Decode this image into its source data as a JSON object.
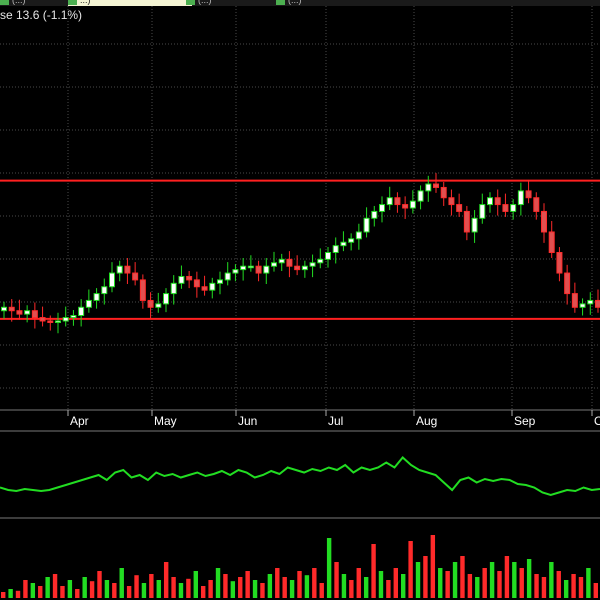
{
  "header": {
    "legend_text": "se 13.6 (-1.1%)",
    "tabs": [
      {
        "label": "(...)",
        "color": "#4caf50"
      },
      {
        "label": "...)",
        "color": "#4caf50"
      },
      {
        "label": "(...)",
        "color": "#4caf50"
      },
      {
        "label": "(...)",
        "color": "#4caf50"
      }
    ]
  },
  "colors": {
    "background": "#000000",
    "grid": "#4a4a4a",
    "up": "#22dd22",
    "down": "#ff2a2a",
    "candle_up_body": "#ffffff",
    "candle_down_body": "#e05050",
    "line": "#22dd22",
    "level_lines": "#ff2020",
    "axis_text": "#ffffff"
  },
  "chart_data": [
    {
      "type": "candlestick",
      "title": "",
      "x_tick_labels": [
        "Apr",
        "May",
        "Jun",
        "Jul",
        "Aug",
        "Sep",
        "O"
      ],
      "grid": true,
      "horizontal_levels": [
        15.35,
        13.33
      ],
      "ylim": [
        12.0,
        17.9
      ],
      "series_close": [
        13.5,
        13.45,
        13.4,
        13.45,
        13.35,
        13.3,
        13.28,
        13.3,
        13.35,
        13.38,
        13.5,
        13.6,
        13.7,
        13.8,
        14.0,
        14.1,
        14.0,
        13.9,
        13.6,
        13.5,
        13.55,
        13.7,
        13.85,
        13.95,
        13.9,
        13.8,
        13.75,
        13.85,
        13.9,
        14.0,
        14.05,
        14.1,
        14.1,
        14.0,
        14.1,
        14.15,
        14.2,
        14.1,
        14.05,
        14.1,
        14.15,
        14.2,
        14.3,
        14.4,
        14.45,
        14.5,
        14.6,
        14.8,
        14.9,
        15.0,
        15.1,
        15.0,
        14.95,
        15.05,
        15.2,
        15.3,
        15.25,
        15.1,
        15.0,
        14.9,
        14.6,
        14.8,
        15.0,
        15.1,
        15.0,
        14.9,
        15.0,
        15.2,
        15.1,
        14.9,
        14.6,
        14.3,
        14.0,
        13.7,
        13.5,
        13.55,
        13.6,
        13.5
      ],
      "series_range": [
        0.15,
        0.3
      ]
    },
    {
      "type": "line",
      "name": "",
      "values": [
        0.55,
        0.5,
        0.48,
        0.52,
        0.5,
        0.48,
        0.5,
        0.55,
        0.6,
        0.65,
        0.7,
        0.75,
        0.8,
        0.7,
        0.85,
        0.9,
        0.75,
        0.8,
        0.7,
        0.85,
        0.78,
        0.82,
        0.75,
        0.8,
        0.85,
        0.78,
        0.82,
        0.88,
        0.8,
        0.9,
        0.85,
        0.75,
        0.8,
        0.88,
        0.82,
        0.95,
        0.9,
        0.85,
        0.92,
        0.88,
        0.95,
        0.9,
        1.0,
        0.85,
        0.95,
        0.9,
        0.95,
        1.05,
        0.95,
        1.15,
        1.0,
        0.9,
        0.85,
        0.8,
        0.65,
        0.5,
        0.7,
        0.75,
        0.65,
        0.72,
        0.68,
        0.72,
        0.7,
        0.62,
        0.6,
        0.55,
        0.45,
        0.4,
        0.45,
        0.5,
        0.48,
        0.55,
        0.5,
        0.52
      ],
      "ylim": [
        0,
        1.5
      ]
    },
    {
      "type": "bar",
      "name": "",
      "values": [
        0.1,
        0.15,
        0.12,
        0.3,
        0.25,
        0.2,
        0.35,
        0.4,
        0.2,
        0.3,
        0.15,
        0.35,
        0.28,
        0.45,
        0.3,
        0.25,
        0.5,
        0.2,
        0.38,
        0.25,
        0.4,
        0.3,
        0.6,
        0.35,
        0.25,
        0.32,
        0.45,
        0.2,
        0.3,
        0.5,
        0.4,
        0.28,
        0.35,
        0.45,
        0.3,
        0.25,
        0.4,
        0.5,
        0.35,
        0.3,
        0.45,
        0.38,
        0.5,
        0.25,
        1.0,
        0.6,
        0.4,
        0.3,
        0.5,
        0.35,
        0.9,
        0.45,
        0.3,
        0.5,
        0.4,
        0.95,
        0.6,
        0.7,
        1.05,
        0.5,
        0.45,
        0.6,
        0.7,
        0.4,
        0.35,
        0.5,
        0.6,
        0.45,
        0.7,
        0.6,
        0.5,
        0.65,
        0.4,
        0.35,
        0.6,
        0.45,
        0.3,
        0.4,
        0.35,
        0.5,
        0.25
      ],
      "ylim": [
        0,
        1.05
      ]
    }
  ]
}
